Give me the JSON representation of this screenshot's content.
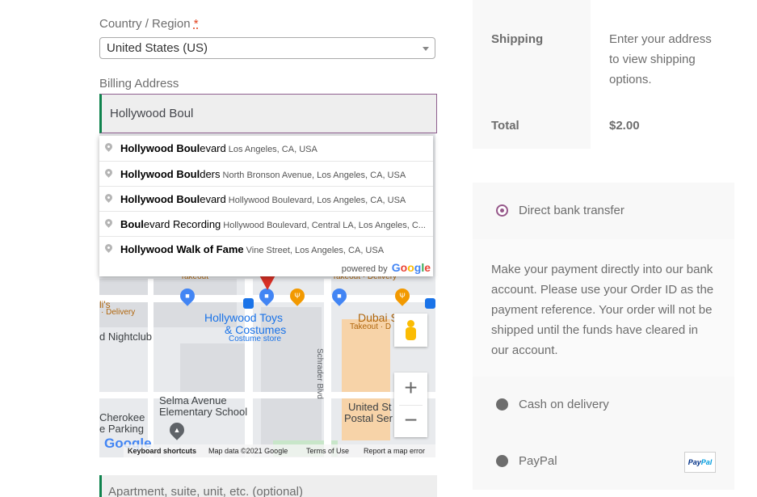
{
  "form": {
    "country_label": "Country / Region",
    "required_mark": "*",
    "country_value": "United States (US)",
    "billing_label": "Billing Address",
    "billing_value": "Hollywood Boul",
    "apartment_placeholder": "Apartment, suite, unit, etc. (optional)"
  },
  "autocomplete": {
    "items": [
      {
        "match": "Hollywood Boul",
        "rest": "evard",
        "secondary": "Los Angeles, CA, USA"
      },
      {
        "match": "Hollywood Boul",
        "rest": "ders",
        "secondary": "North Bronson Avenue, Los Angeles, CA, USA"
      },
      {
        "match": "Hollywood Boul",
        "rest": "evard",
        "secondary": "Hollywood Boulevard, Los Angeles, CA, USA"
      },
      {
        "match": "Boul",
        "rest": "evard Recording",
        "secondary": "Hollywood Boulevard, Central LA, Los Angeles, C..."
      },
      {
        "match": "Hollywood Walk of Fame",
        "rest": "",
        "secondary": "Vine Street, Los Angeles, CA, USA"
      }
    ],
    "powered_by": "powered by",
    "google": "Google"
  },
  "map": {
    "labels": {
      "takeout1": "Takeout",
      "takeout2": "Takeout · Delivery",
      "lis": "li's",
      "delivery": "· Delivery",
      "nightclub": "d Nightclub",
      "toys1": "Hollywood Toys",
      "toys2": "& Costumes",
      "costume_store": "Costume store",
      "schrader": "Schrader Blvd",
      "dubai": "Dubai S",
      "dubai_sub": "Takeout · D",
      "selma1": "Selma Avenue",
      "selma2": "Elementary School",
      "cherokee1": "Cherokee",
      "cherokee2": "e Parking",
      "usps1": "United St",
      "usps2": "Postal Ser"
    },
    "zoom_in": "+",
    "zoom_out": "−",
    "logo": "Google",
    "footer": {
      "shortcuts": "Keyboard shortcuts",
      "data": "Map data ©2021 Google",
      "terms": "Terms of Use",
      "report": "Report a map error"
    }
  },
  "summary": {
    "shipping_label": "Shipping",
    "shipping_line1": "Enter your address",
    "shipping_line2": "to view shipping",
    "shipping_line3": "options.",
    "total_label": "Total",
    "total_value": "$2.00"
  },
  "payment": {
    "methods": [
      {
        "label": "Direct bank transfer",
        "selected": true
      },
      {
        "label": "Cash on delivery",
        "selected": false
      },
      {
        "label": "PayPal",
        "selected": false
      }
    ],
    "bank_desc_lines": [
      "Make your payment directly into our bank",
      "account. Please use your Order ID as the",
      "payment reference. Your order will not be",
      "shipped until the funds have cleared in",
      "our account."
    ],
    "paypal_logo": "PayPal"
  },
  "colors": {
    "accent": "#96588a",
    "focus_border": "#0f834d",
    "text": "#6d6d6d",
    "link_blue": "#1a73e8"
  }
}
